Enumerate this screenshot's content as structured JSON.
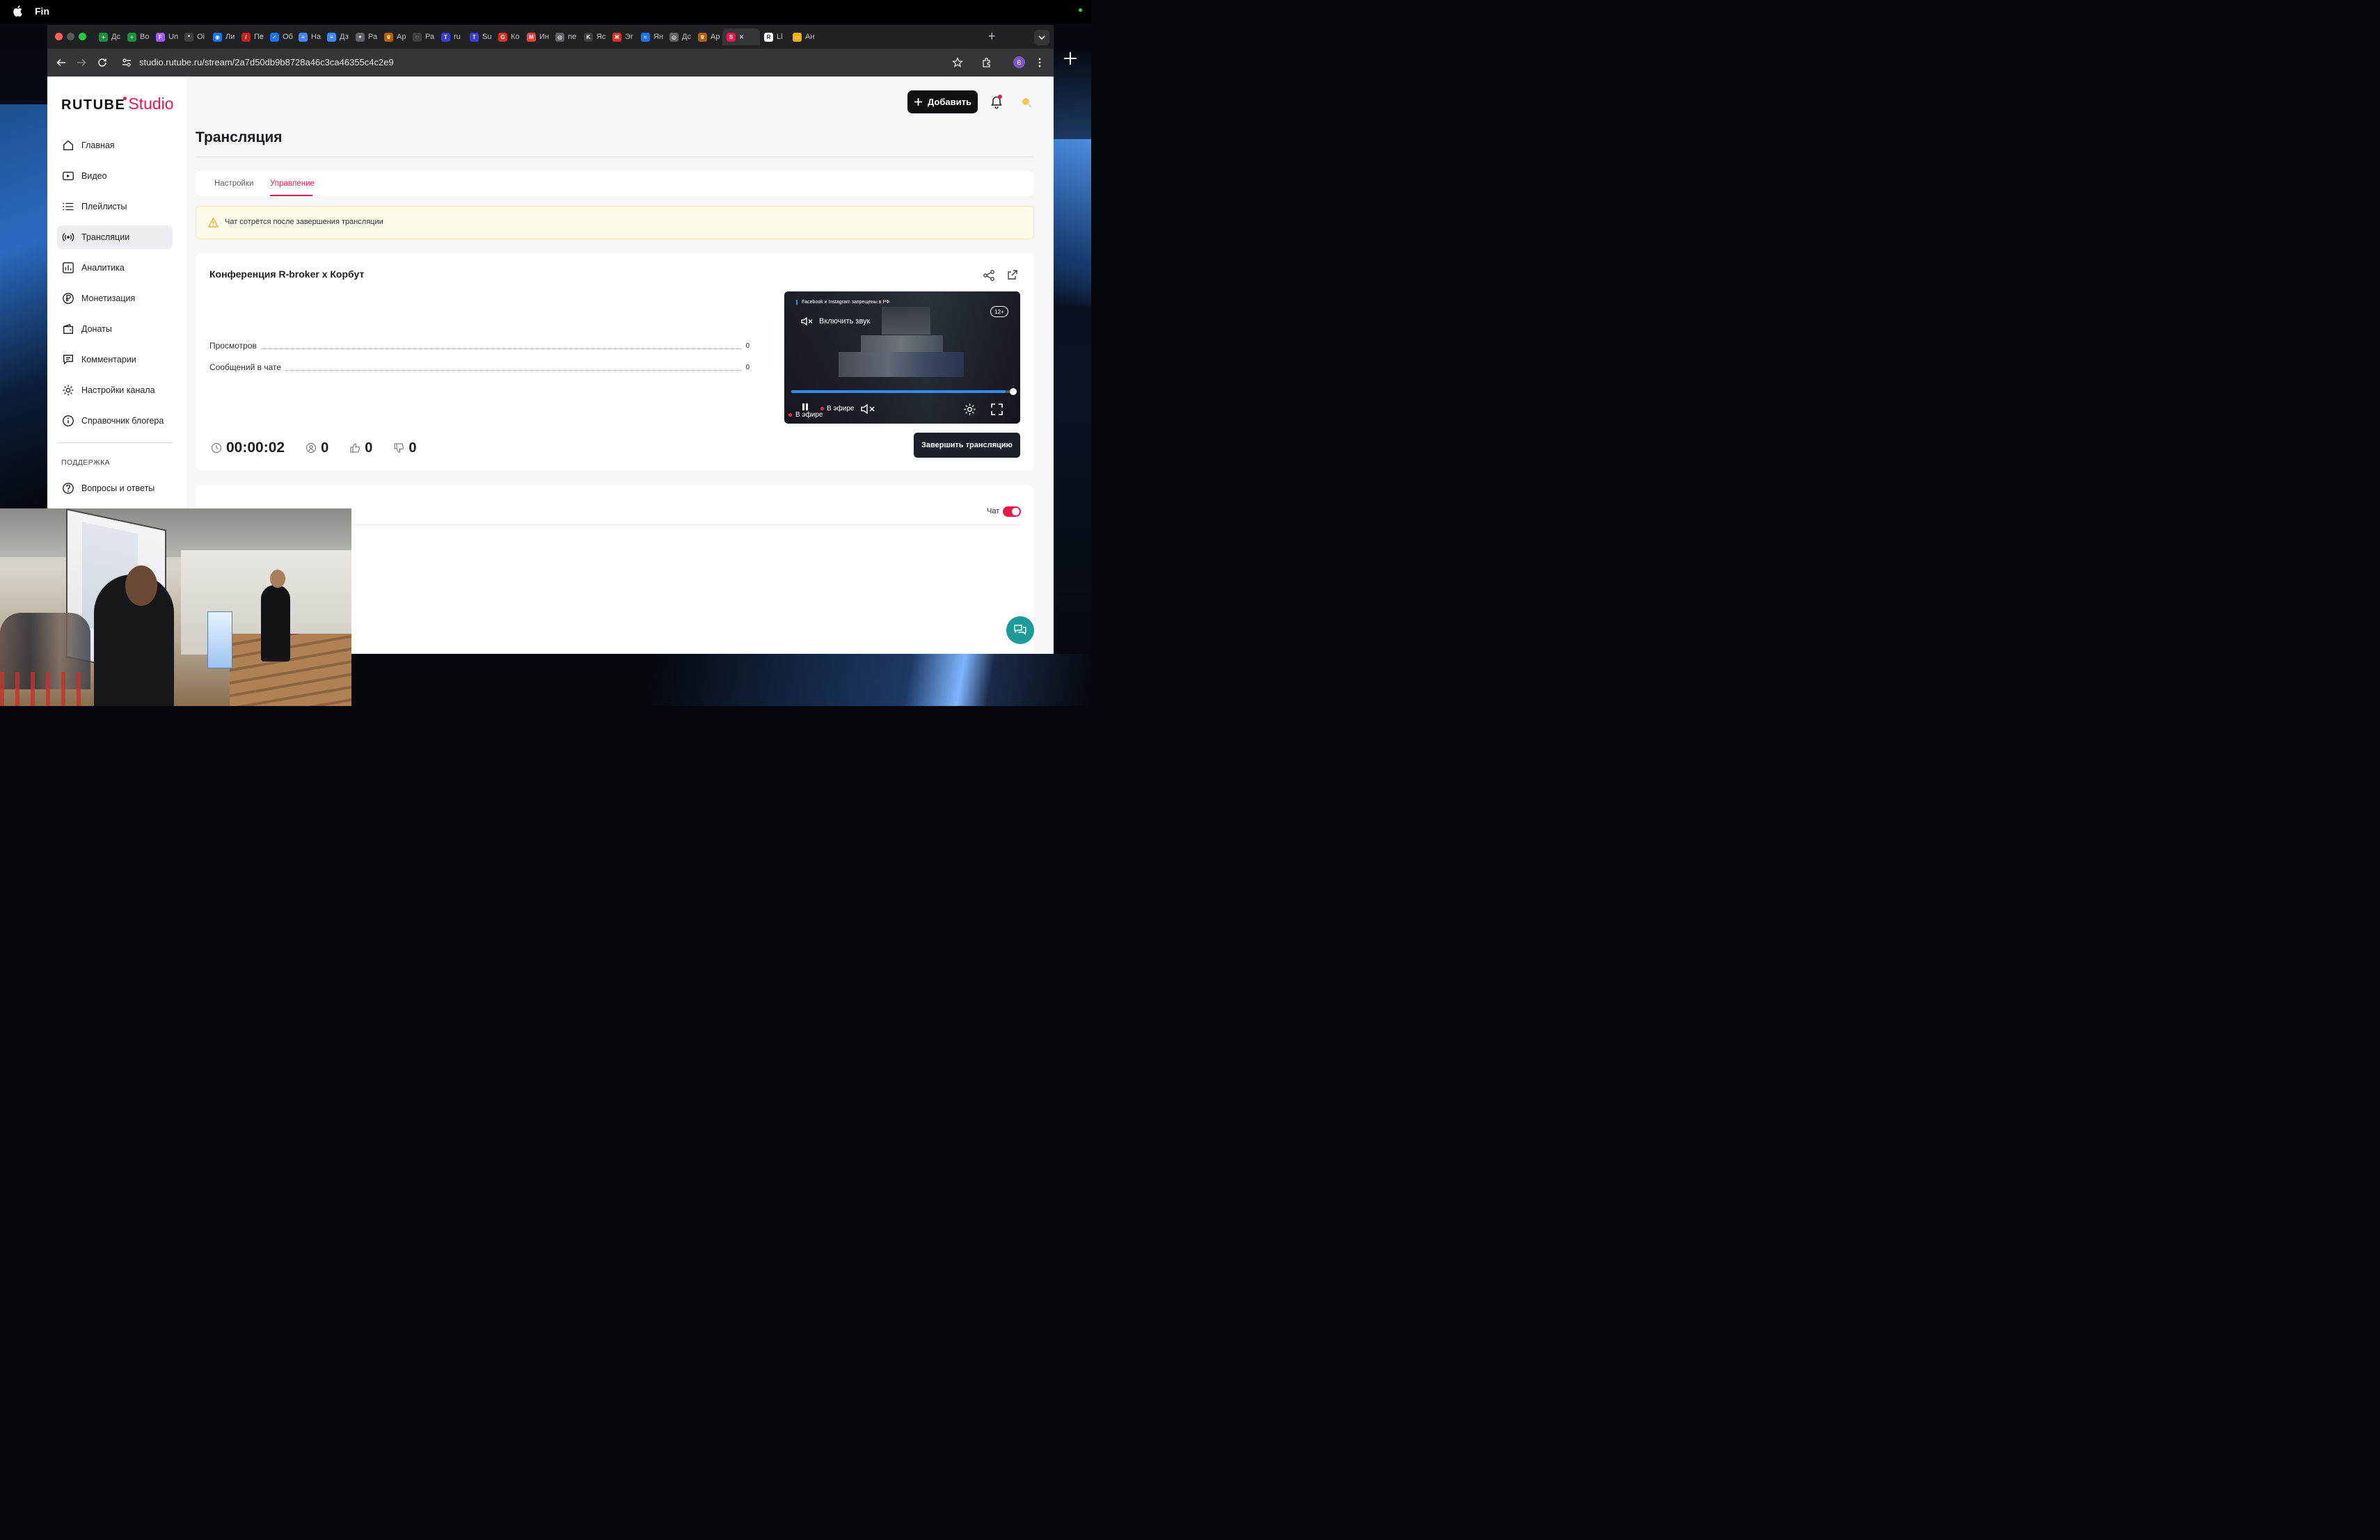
{
  "os": {
    "menubar_app": "Fin"
  },
  "browser": {
    "tabs": [
      {
        "label": "Дс",
        "color": "#1e8e3e",
        "glyph": "+"
      },
      {
        "label": "Во",
        "color": "#1e8e3e",
        "glyph": "+"
      },
      {
        "label": "Un",
        "color": "#a259ff",
        "glyph": "F"
      },
      {
        "label": "Оі",
        "color": "#3c4043",
        "glyph": "*"
      },
      {
        "label": "Ли",
        "color": "#1a73e8",
        "glyph": "◉"
      },
      {
        "label": "Пе",
        "color": "#c5221f",
        "glyph": "/"
      },
      {
        "label": "Об",
        "color": "#1a73e8",
        "glyph": "✓"
      },
      {
        "label": "На",
        "color": "#4285f4",
        "glyph": "≡"
      },
      {
        "label": "Дз",
        "color": "#4285f4",
        "glyph": "≡"
      },
      {
        "label": "Ра",
        "color": "#5f6368",
        "glyph": "✦"
      },
      {
        "label": "Ар",
        "color": "#b06000",
        "glyph": "♛"
      },
      {
        "label": "Ра",
        "color": "#3c4043",
        "glyph": "◌"
      },
      {
        "label": "ru",
        "color": "#3b3bd6",
        "glyph": "T"
      },
      {
        "label": "Su",
        "color": "#3b3bd6",
        "glyph": "T"
      },
      {
        "label": "Ко",
        "color": "#d93025",
        "glyph": "G"
      },
      {
        "label": "Ин",
        "color": "#ea4335",
        "glyph": "M"
      },
      {
        "label": "ne",
        "color": "#5f6368",
        "glyph": "◍"
      },
      {
        "label": "Яс",
        "color": "#3c4043",
        "glyph": "K"
      },
      {
        "label": "Эг",
        "color": "#d93025",
        "glyph": "Ж"
      },
      {
        "label": "Ян",
        "color": "#1a73e8",
        "glyph": "≈"
      },
      {
        "label": "Дс",
        "color": "#5f6368",
        "glyph": "◍"
      },
      {
        "label": "Ар",
        "color": "#b06000",
        "glyph": "♛"
      }
    ],
    "active_tab": {
      "glyph": "S",
      "color": "#e5184d"
    },
    "tabs_after": [
      {
        "label": "Ll",
        "color": "#ffffff",
        "glyph": "R"
      },
      {
        "label": "Ан",
        "color": "#f9ab00",
        "glyph": "▭"
      }
    ],
    "url": "studio.rutube.ru/stream/2a7d50db9b8728a46c3ca46355c4c2e9",
    "profile_initial": "B"
  },
  "header": {
    "logo_main": "RUTUBE",
    "logo_sub": "Studio",
    "add_label": "Добавить"
  },
  "sidebar": {
    "items": [
      {
        "label": "Главная",
        "icon": "home-icon"
      },
      {
        "label": "Видео",
        "icon": "video-icon"
      },
      {
        "label": "Плейлисты",
        "icon": "playlist-icon"
      },
      {
        "label": "Трансляции",
        "icon": "broadcast-icon",
        "active": true
      },
      {
        "label": "Аналитика",
        "icon": "analytics-icon"
      },
      {
        "label": "Монетизация",
        "icon": "ruble-icon"
      },
      {
        "label": "Донаты",
        "icon": "wallet-icon"
      },
      {
        "label": "Комментарии",
        "icon": "comment-icon"
      },
      {
        "label": "Настройки канала",
        "icon": "gear-icon"
      },
      {
        "label": "Справочник блогера",
        "icon": "info-icon"
      }
    ],
    "support_heading": "ПОДДЕРЖКА",
    "support_items": [
      {
        "label": "Вопросы и ответы",
        "icon": "question-icon"
      }
    ]
  },
  "main": {
    "title": "Трансляция",
    "tabs": [
      {
        "label": "Настройки",
        "active": false
      },
      {
        "label": "Управление",
        "active": true
      }
    ],
    "alert": "Чат сотрётся после завершения трансляции",
    "stream": {
      "title": "Конференция R-broker x Корбут",
      "stats": [
        {
          "label": "Просмотров",
          "value": "0"
        },
        {
          "label": "Сообщений в чате",
          "value": "0"
        }
      ],
      "duration": "00:00:02",
      "viewers": "0",
      "likes": "0",
      "dislikes": "0",
      "end_label": "Завершить трансляцию"
    },
    "player": {
      "notice": "Facebook и Instagram запрещены в РФ",
      "age": "12+",
      "unmute_label": "Включить звук",
      "live_label_top": "В эфире",
      "live_label_bottom": "В эфире",
      "progress": 0.97
    },
    "chat": {
      "label": "Чат",
      "enabled": true
    }
  },
  "colors": {
    "accent": "#e5184d",
    "player_progress": "#2d8cff",
    "alert_bg": "#fffbea"
  }
}
